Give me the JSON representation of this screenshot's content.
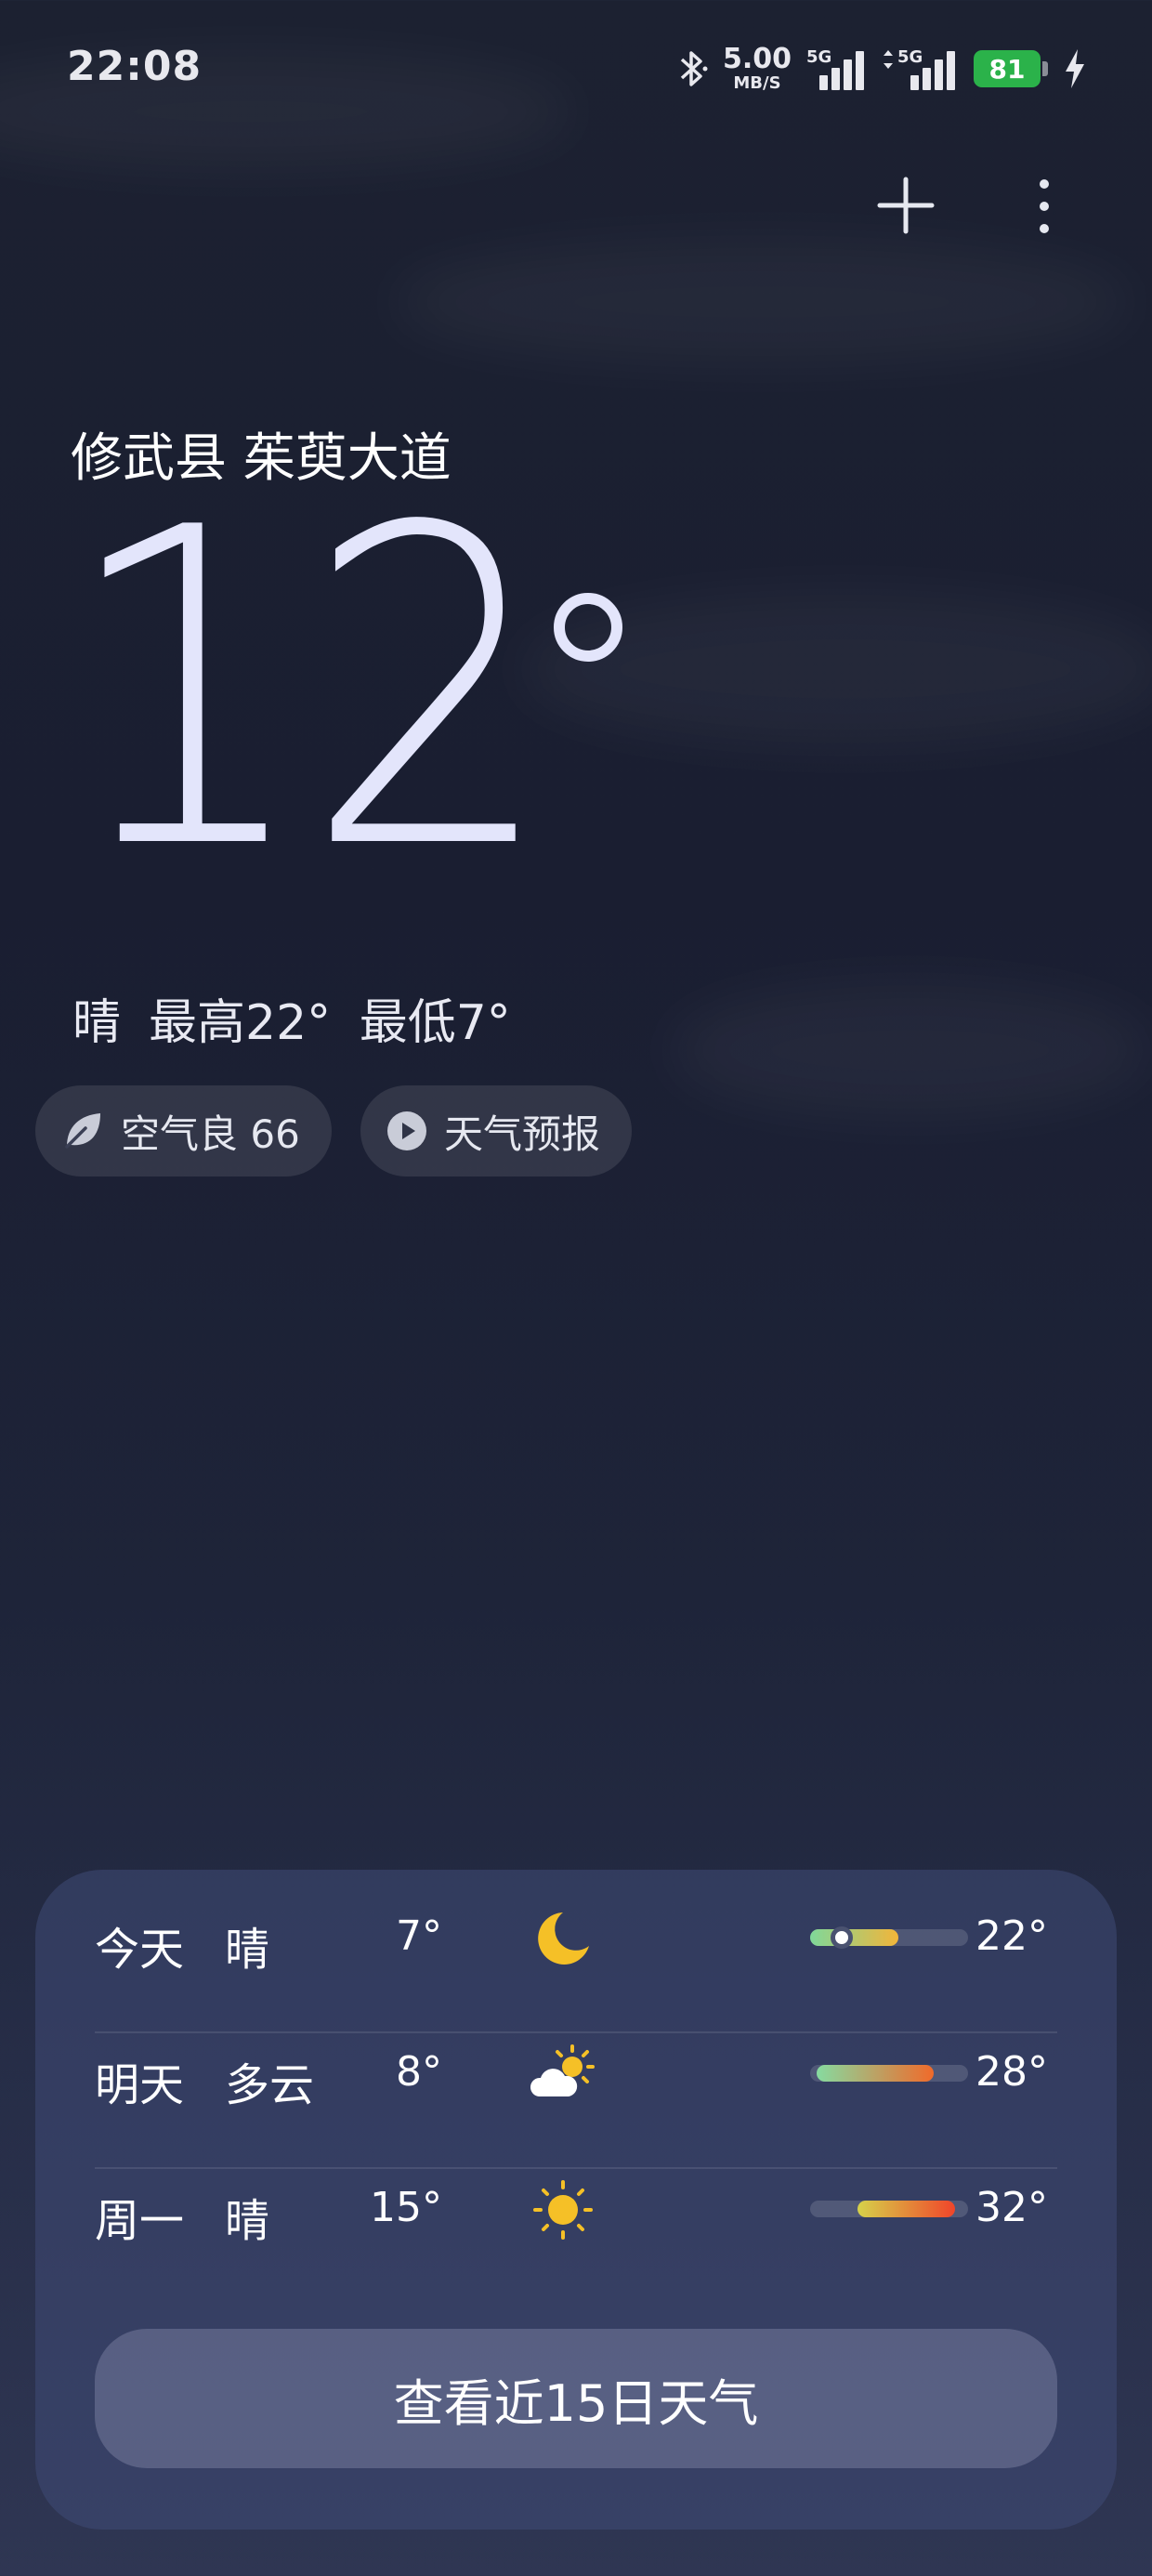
{
  "status_bar": {
    "time": "22:08",
    "net_speed_value": "5.00",
    "net_speed_unit": "MB/S",
    "sim1_tag": "5G",
    "sim2_tag": "5G",
    "battery_level": "81",
    "battery_color": "#2bb24a"
  },
  "toolbar": {
    "add_icon": "plus-icon",
    "menu_icon": "more-vertical-icon"
  },
  "current": {
    "location": "修武县 茱萸大道",
    "temperature": "12",
    "condition": "晴",
    "high": "最高22°",
    "low": "最低7°"
  },
  "chips": {
    "air_quality": "空气良 66",
    "forecast_video": "天气预报"
  },
  "daily": [
    {
      "day": "今天",
      "condition": "晴",
      "icon": "moon-icon",
      "low": "7°",
      "high": "22°",
      "bar_start": 0.0,
      "bar_end": 0.56,
      "now_marker": 0.2,
      "bar_from": "#7fd89a",
      "bar_to": "#f2b53a"
    },
    {
      "day": "明天",
      "condition": "多云",
      "icon": "partly-cloudy-icon",
      "low": "8°",
      "high": "28°",
      "bar_start": 0.04,
      "bar_end": 0.78,
      "bar_from": "#86dba0",
      "bar_to": "#f06a2a"
    },
    {
      "day": "周一",
      "condition": "晴",
      "icon": "sun-icon",
      "low": "15°",
      "high": "32°",
      "bar_start": 0.3,
      "bar_end": 0.92,
      "bar_from": "#d6d24a",
      "bar_to": "#f0452a"
    }
  ],
  "more_button": "查看近15日天气"
}
